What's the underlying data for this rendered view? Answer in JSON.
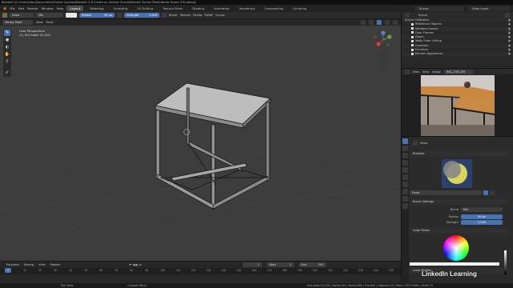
{
  "window": {
    "title": "Blender* [C:\\Users\\darr\\Documents\\Online Courses\\Blender 2.8 Create an Interior Scene\\Blender Scene Files\\Interior Scene 07b.blend]"
  },
  "menubar": {
    "menus": [
      "File",
      "Edit",
      "Render",
      "Window",
      "Help"
    ],
    "workspaces": [
      "Layout",
      "Modeling",
      "Sculpting",
      "UV Editing",
      "Texture Paint",
      "Shading",
      "Animation",
      "Rendering",
      "Compositing",
      "Scripting"
    ],
    "active_workspace": "Layout",
    "scene": "Scene",
    "view_layer": "View Layer"
  },
  "tool_header": {
    "brush": "Draw",
    "blend": "Mix",
    "radius_label": "Radius",
    "radius_value": "50 px",
    "strength_label": "Strength",
    "strength_value": "1.000",
    "menus": [
      "Brush",
      "Texture",
      "Stroke",
      "Falloff",
      "Cursor"
    ]
  },
  "view_header": {
    "mode": "Vertex Paint",
    "items": [
      "View",
      "Paint"
    ]
  },
  "viewport": {
    "info_line1": "User Perspective",
    "info_line2": "(1) End table 01.001",
    "gizmo_axes": [
      "Z",
      "Y",
      "X"
    ]
  },
  "toolbar": {
    "tools": [
      "draw-tool",
      "blur-tool",
      "average-tool",
      "smear-tool",
      "sample-tool",
      "annotate-tool"
    ]
  },
  "outliner": {
    "header_label": "Scene",
    "items": [
      {
        "label": "Scene Collection",
        "indent": 0
      },
      {
        "label": "Reference Objects",
        "indent": 1
      },
      {
        "label": "Window Frames",
        "indent": 1
      },
      {
        "label": "Door Frames",
        "indent": 1
      },
      {
        "label": "Doors",
        "indent": 1
      },
      {
        "label": "Walls Floor Ceiling",
        "indent": 1
      },
      {
        "label": "Counters",
        "indent": 1
      },
      {
        "label": "Furniture",
        "indent": 1
      },
      {
        "label": "Kitchen Appliances",
        "indent": 1
      }
    ]
  },
  "image_editor": {
    "menus": [
      "View",
      "View",
      "Image"
    ],
    "image_name": "IMG_2781.JPG"
  },
  "properties": {
    "tool_name": "Draw",
    "brushes_title": "Brushes",
    "brush_name": "Draw",
    "brush_settings_title": "Brush Settings",
    "blend_label": "Blend",
    "blend_value": "Mix",
    "radius_label": "Radius",
    "radius_value": "50 px",
    "strength_label": "Strength",
    "strength_value": "1.000",
    "color_picker_title": "Color Picker",
    "color_palette_title": "Color Palette"
  },
  "timeline": {
    "menus": [
      "Playback",
      "Keying",
      "View",
      "Marker"
    ],
    "current_frame": "1",
    "start_label": "Start",
    "start_value": "1",
    "end_label": "End",
    "end_value": "250",
    "ruler": [
      "0",
      "10",
      "20",
      "30",
      "40",
      "50",
      "60",
      "70",
      "80",
      "90",
      "100",
      "110",
      "120",
      "130",
      "140",
      "150",
      "160",
      "170",
      "180",
      "190",
      "200",
      "210",
      "220",
      "230",
      "240",
      "250"
    ]
  },
  "statusbar": {
    "left": "Pan View",
    "mid": "Context Menu",
    "stats": "End table 01.001 | Verts:132 | Faces:266 | Tris:452 | Objects:1/2 | Mem: 221.5 MiB | v2.80.75"
  },
  "watermark": "LinkedIn Learning",
  "colors": {
    "accent": "#4772b3",
    "viewport_bg": "#3d3d3d",
    "panel_bg": "#2b2b2b"
  }
}
